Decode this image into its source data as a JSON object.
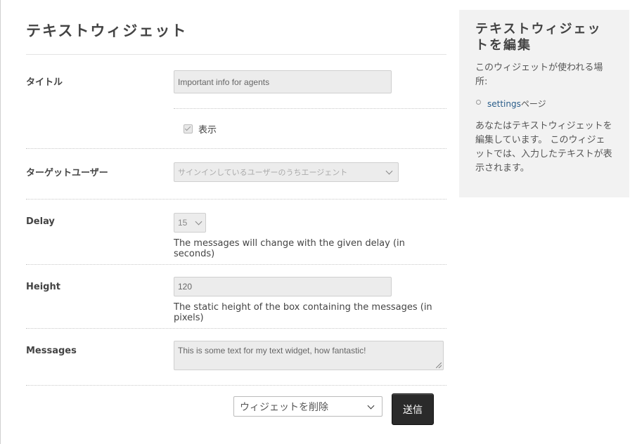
{
  "page": {
    "title": "テキストウィジェット"
  },
  "form": {
    "title_field": {
      "label": "タイトル",
      "value": "Important info for agents"
    },
    "show_checkbox": {
      "label": "表示",
      "checked": true
    },
    "target_users": {
      "label": "ターゲットユーザー",
      "selected": "サインインしているユーザーのうちエージェント"
    },
    "delay": {
      "label": "Delay",
      "selected": "15",
      "help": "The messages will change with the given delay (in seconds)"
    },
    "height": {
      "label": "Height",
      "value": "120",
      "help": "The static height of the box containing the messages (in pixels)"
    },
    "messages": {
      "label": "Messages",
      "value": "This is some text for my text widget, how fantastic!"
    }
  },
  "actions": {
    "select_selected": "ウィジェットを削除",
    "submit_label": "送信"
  },
  "sidebar": {
    "title": "テキストウィジェットを編集",
    "used_in": "このウィジェットが使われる場所:",
    "link_text": "settings",
    "link_suffix": "ページ",
    "description": "あなたはテキストウィジェットを編集しています。 このウィジェットでは、入力したテキストが表示されます。"
  },
  "colors": {
    "submit_bg": "#2a2a2a",
    "sidebar_bg": "#f2f2f2",
    "link": "#2a5d8a"
  },
  "icons": {
    "checkbox": "check-icon",
    "select_arrow": "chevron-down-icon",
    "bullet": "circle-bullet-icon"
  }
}
